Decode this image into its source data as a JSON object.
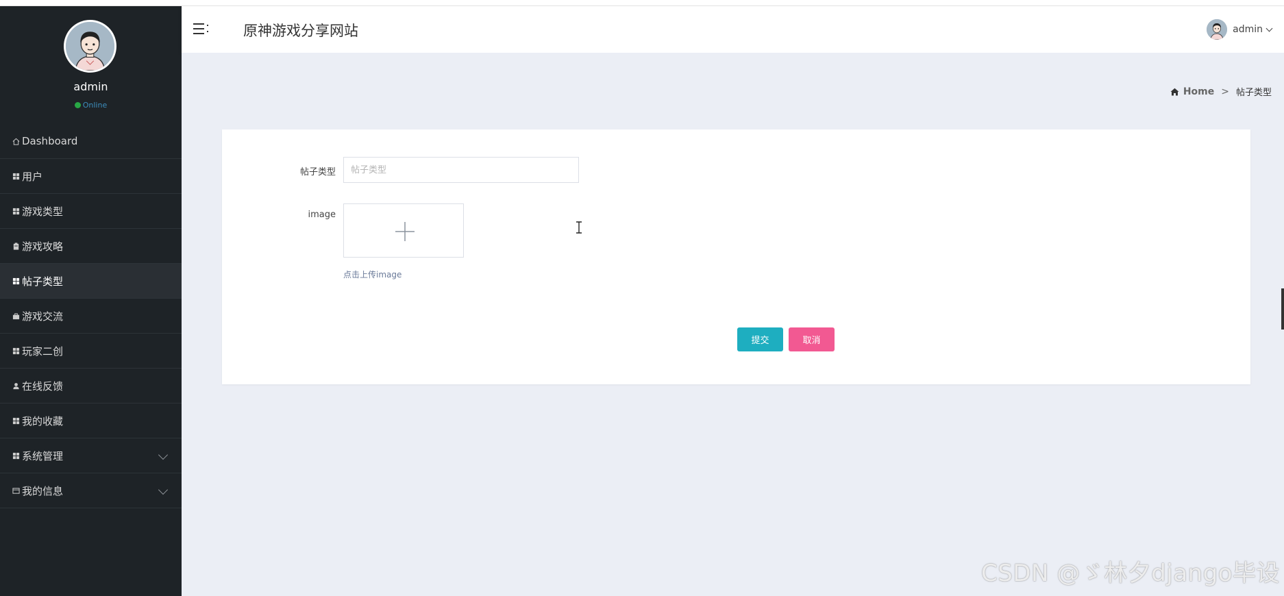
{
  "app": {
    "site_title": "原神游戏分享网站",
    "user_menu_name": "admin"
  },
  "sidebar": {
    "profile": {
      "name": "admin",
      "status": "Online"
    },
    "items": [
      {
        "label": "Dashboard",
        "icon": "home-outline-icon",
        "active": false
      },
      {
        "label": "用户",
        "icon": "grid-icon",
        "active": false
      },
      {
        "label": "游戏类型",
        "icon": "grid-icon",
        "active": false
      },
      {
        "label": "游戏攻略",
        "icon": "clipboard-icon",
        "active": false
      },
      {
        "label": "帖子类型",
        "icon": "grid-icon",
        "active": true
      },
      {
        "label": "游戏交流",
        "icon": "briefcase-icon",
        "active": false
      },
      {
        "label": "玩家二创",
        "icon": "grid-icon",
        "active": false
      },
      {
        "label": "在线反馈",
        "icon": "user-icon",
        "active": false
      },
      {
        "label": "我的收藏",
        "icon": "grid-icon",
        "active": false
      },
      {
        "label": "系统管理",
        "icon": "grid-icon",
        "active": false,
        "expandable": true
      },
      {
        "label": "我的信息",
        "icon": "card-icon",
        "active": false,
        "expandable": true
      }
    ]
  },
  "breadcrumb": {
    "home": "Home",
    "separator": ">",
    "current": "帖子类型"
  },
  "form": {
    "type_label": "帖子类型",
    "type_value": "",
    "type_placeholder": "帖子类型",
    "image_label": "image",
    "upload_hint": "点击上传image",
    "submit_label": "提交",
    "cancel_label": "取消"
  },
  "watermark": "CSDN @ゞ林夕django毕设",
  "colors": {
    "sidebar_bg": "#1e2327",
    "content_bg": "#ebeef5",
    "submit": "#1eaec0",
    "cancel": "#f25992",
    "online": "#28a745"
  }
}
